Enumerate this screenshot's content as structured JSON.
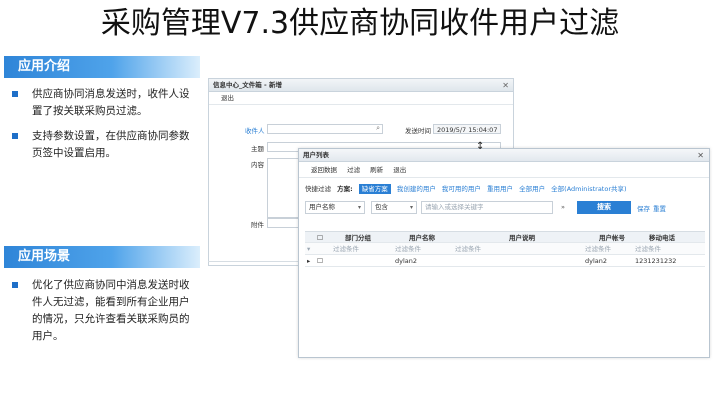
{
  "slide": {
    "title": "采购管理V7.3供应商协同收件用户过滤"
  },
  "intro": {
    "header": "应用介绍",
    "bullets": [
      "供应商协同消息发送时，收件人设置了按关联采购员过滤。",
      "支持参数设置，在供应商协同参数页签中设置启用。"
    ]
  },
  "scene": {
    "header": "应用场景",
    "bullets": [
      "优化了供应商协同中消息发送时收件人无过滤，能看到所有企业用户的情况，只允许查看关联采购员的用户。"
    ]
  },
  "message_window": {
    "title": "信息中心_文件箱 - 新增",
    "exit": "退出",
    "recipient_label": "收件人",
    "subject_label": "主题",
    "content_label": "内容",
    "attachment_label": "附件",
    "send_time_label": "发送时间",
    "send_time_value": "2019/5/7 15:04:07"
  },
  "user_window": {
    "title": "用户列表",
    "toolbar": [
      "返回数据",
      "过滤",
      "刷新",
      "退出"
    ],
    "quick_filter_label": "快捷过滤",
    "scheme_label": "方案:",
    "schemes_active": "缺省方案",
    "schemes": [
      "我创建的用户",
      "我可用的用户",
      "重用用户",
      "全部用户",
      "全部(Administrator共享)"
    ],
    "field_select": "用户名称",
    "operator_select": "包含",
    "search_placeholder": "请输入或选择关键字",
    "search_button": "搜索",
    "save_link": "保存",
    "reset_link": "重置",
    "columns": [
      "部门分组",
      "用户名称",
      "用户说明",
      "用户帐号",
      "移动电话"
    ],
    "filter_row": [
      "过滤条件",
      "过滤条件",
      "过滤条件",
      "过滤条件",
      "过滤条件"
    ],
    "rows": [
      {
        "name": "dylan2",
        "desc": "",
        "account": "dylan2",
        "phone": "1231231232"
      }
    ]
  }
}
